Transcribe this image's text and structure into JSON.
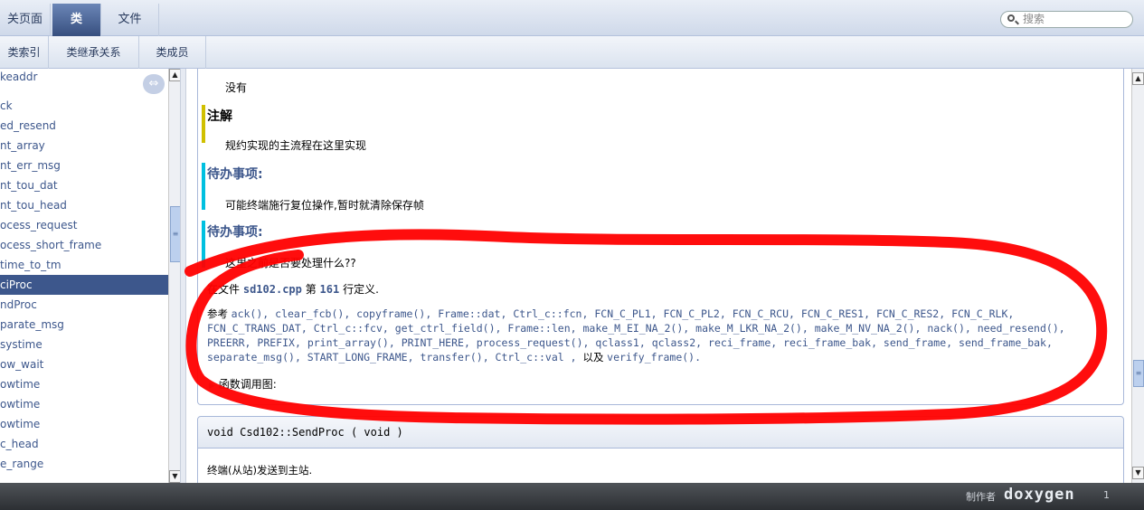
{
  "nav": {
    "tabs": [
      "关页面",
      "类",
      "文件"
    ],
    "search_placeholder": "搜索"
  },
  "subnav": {
    "tabs": [
      "类索引",
      "类继承关系",
      "类成员"
    ]
  },
  "tree": {
    "items": [
      "keaddr",
      "ck",
      "ed_resend",
      "nt_array",
      "nt_err_msg",
      "nt_tou_dat",
      "nt_tou_head",
      "ocess_request",
      "ocess_short_frame",
      "time_to_tm",
      "ciProc",
      "ndProc",
      "parate_msg",
      "systime",
      "ow_wait",
      "owtime",
      "owtime",
      "owtime",
      "c_head",
      "e_range"
    ],
    "selected_index": 10
  },
  "doc": {
    "return_text": "没有",
    "note_title": "注解",
    "note_text": "规约实现的主流程在这里实现",
    "todo1_title": "待办事项:",
    "todo1_text": "可能终端施行复位操作,暂时就清除保存帧",
    "todo2_title": "待办事项:",
    "todo2_text": "这里之前是否要处理什么??",
    "defined_prefix": "在文件",
    "defined_file": "sd102.cpp",
    "defined_mid": "第",
    "defined_line": "161",
    "defined_suffix": "行定义.",
    "refs_prefix": "参考",
    "refs": [
      "ack()",
      "clear_fcb()",
      "copyframe()",
      "Frame::dat",
      "Ctrl_c::fcn",
      "FCN_C_PL1",
      "FCN_C_PL2",
      "FCN_C_RCU",
      "FCN_C_RES1",
      "FCN_C_RES2",
      "FCN_C_RLK",
      "FCN_C_TRANS_DAT",
      "Ctrl_c::fcv",
      "get_ctrl_field()",
      "Frame::len",
      "make_M_EI_NA_2()",
      "make_M_LKR_NA_2()",
      "make_M_NV_NA_2()",
      "nack()",
      "need_resend()",
      "PREERR",
      "PREFIX",
      "print_array()",
      "PRINT_HERE",
      "process_request()",
      "qclass1",
      "qclass2",
      "reci_frame",
      "reci_frame_bak",
      "send_frame",
      "send_frame_bak",
      "separate_msg()",
      "START_LONG_FRAME",
      "transfer()",
      "Ctrl_c::val"
    ],
    "refs_and": "以及",
    "refs_last": "verify_frame()",
    "callgraph_label": "函数调用图:",
    "proto": "void Csd102::SendProc ( void    )",
    "brief": "终端(从站)发送到主站."
  },
  "footer": {
    "generated_by": "制作者",
    "logo": "doxygen",
    "version": "1"
  },
  "colors": {
    "link": "#3d578c",
    "note_bar": "#d0c000",
    "todo_bar": "#00c0e0",
    "annotation": "#ff0000"
  }
}
